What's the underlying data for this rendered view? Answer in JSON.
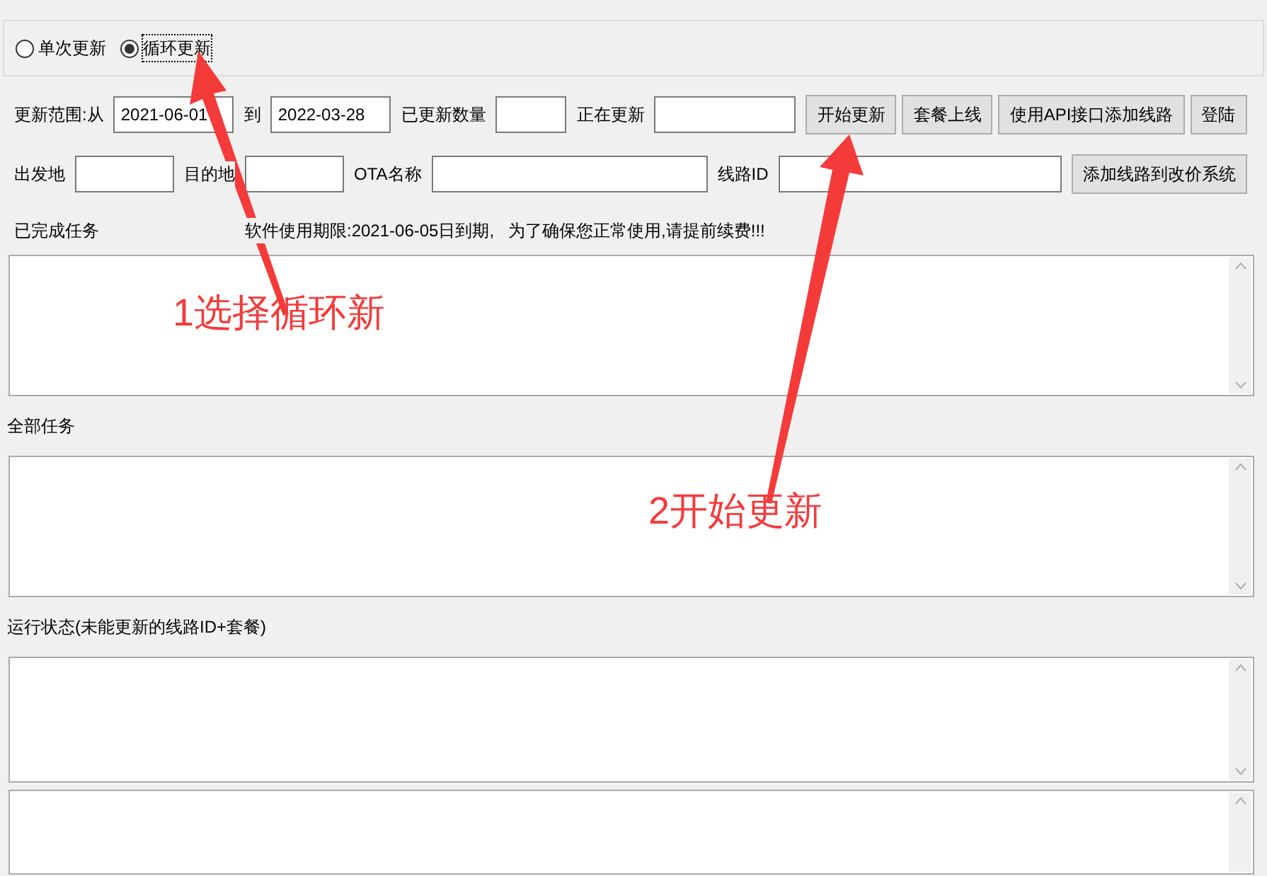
{
  "update_mode": [
    {
      "label": "单次更新",
      "selected": false
    },
    {
      "label": "循环更新",
      "selected": true
    }
  ],
  "row1": [
    {
      "kind": "label",
      "text": "更新范围:从"
    },
    {
      "kind": "field",
      "value": "2021-06-01"
    },
    {
      "kind": "label",
      "text": "到"
    },
    {
      "kind": "field",
      "value": "2022-03-28"
    },
    {
      "kind": "label",
      "text": "已更新数量"
    },
    {
      "kind": "field"
    },
    {
      "kind": "label",
      "text": "正在更新"
    },
    {
      "kind": "field"
    },
    {
      "kind": "button",
      "text": "开始更新"
    },
    {
      "kind": "button",
      "text": "套餐上线"
    },
    {
      "kind": "button",
      "text": "使用API接口添加线路"
    },
    {
      "kind": "button",
      "text": "登陆"
    }
  ],
  "row2": [
    {
      "kind": "label",
      "text": "出发地"
    },
    {
      "kind": "field"
    },
    {
      "kind": "label",
      "text": "目的地"
    },
    {
      "kind": "field"
    },
    {
      "kind": "label",
      "text": "OTA名称"
    },
    {
      "kind": "field"
    },
    {
      "kind": "label",
      "text": "线路ID"
    },
    {
      "kind": "field"
    },
    {
      "kind": "button",
      "text": "添加线路到改价系统"
    }
  ],
  "completed_label": "已完成任务",
  "license_notice": "软件使用期限:2021-06-05日到期,   为了确保您正常使用,请提前续费!!!",
  "all_tasks_label": "全部任务",
  "status_label": "运行状态(未能更新的线路ID+套餐)",
  "annotations": [
    {
      "text": "1选择循环新"
    },
    {
      "text": "2开始更新"
    }
  ]
}
